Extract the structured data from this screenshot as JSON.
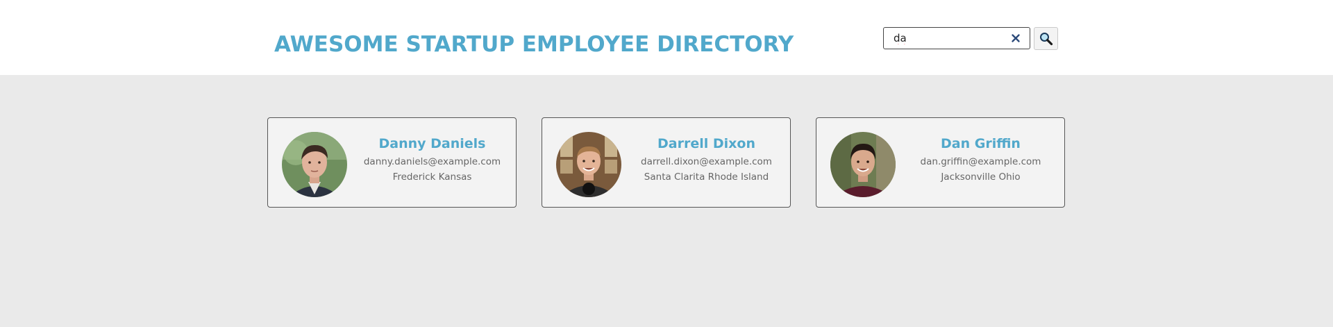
{
  "header": {
    "title": "AWESOME STARTUP EMPLOYEE DIRECTORY"
  },
  "search": {
    "value": "da",
    "clear_icon": "close-icon",
    "button_icon": "search-icon"
  },
  "colors": {
    "accent": "#51a8cb",
    "background": "#eaeaea",
    "card": "#f3f3f3"
  },
  "employees": [
    {
      "name": "Danny Daniels",
      "email": "danny.daniels@example.com",
      "location": "Frederick Kansas",
      "avatar": "avatar-photo"
    },
    {
      "name": "Darrell Dixon",
      "email": "darrell.dixon@example.com",
      "location": "Santa Clarita Rhode Island",
      "avatar": "avatar-photo"
    },
    {
      "name": "Dan Griffin",
      "email": "dan.griffin@example.com",
      "location": "Jacksonville Ohio",
      "avatar": "avatar-photo"
    }
  ]
}
